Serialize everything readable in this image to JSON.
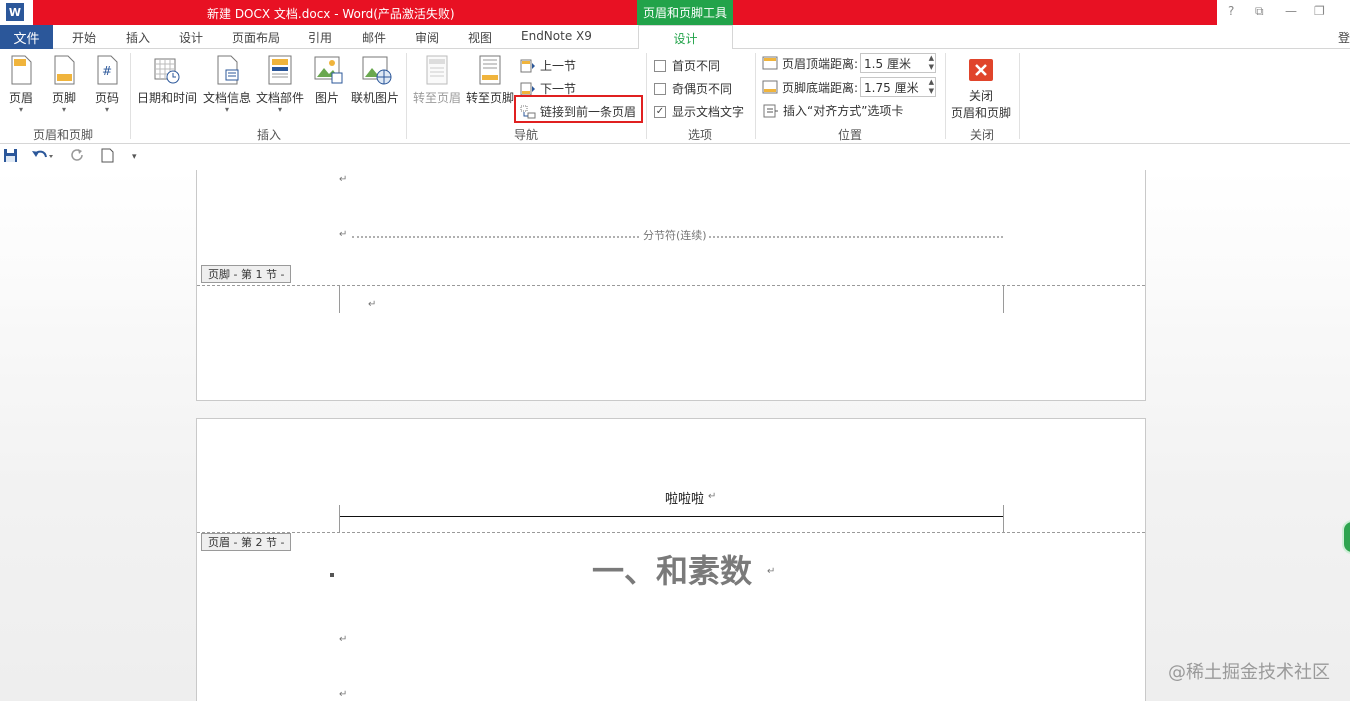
{
  "titlebar": {
    "app_icon_letter": "W",
    "title": "新建 DOCX 文档.docx -  Word(产品激活失败)",
    "context_tool": "页眉和页脚工具",
    "controls": [
      "?",
      "⧉",
      "—",
      "❐"
    ]
  },
  "tabs": {
    "file": "文件",
    "items": [
      "开始",
      "插入",
      "设计",
      "页面布局",
      "引用",
      "邮件",
      "审阅",
      "视图",
      "EndNote X9"
    ],
    "design": "设计",
    "signin": "登"
  },
  "ribbon": {
    "groups": {
      "header_footer": {
        "label": "页眉和页脚",
        "buttons": [
          "页眉",
          "页脚",
          "页码"
        ]
      },
      "insert": {
        "label": "插入",
        "buttons": [
          "日期和时间",
          "文档信息",
          "文档部件",
          "图片",
          "联机图片"
        ]
      },
      "navigation": {
        "label": "导航",
        "goto_header": "转至页眉",
        "goto_footer": "转至页脚",
        "prev_section": "上一节",
        "next_section": "下一节",
        "link_to_previous": "链接到前一条页眉"
      },
      "options": {
        "label": "选项",
        "first_page_diff": "首页不同",
        "odd_even_diff": "奇偶页不同",
        "show_doc_text": "显示文档文字",
        "show_doc_text_checked": true
      },
      "position": {
        "label": "位置",
        "header_top_label": "页眉顶端距离:",
        "header_top_value": "1.5 厘米",
        "footer_bottom_label": "页脚底端距离:",
        "footer_bottom_value": "1.75 厘米",
        "insert_align_tab": "插入“对齐方式”选项卡"
      },
      "close": {
        "label": "关闭",
        "button_line1": "关闭",
        "button_line2": "页眉和页脚"
      }
    },
    "colors": {
      "highlight": "#e02020",
      "file_tab": "#2b579a",
      "context": "#22a34a",
      "title_red": "#e81123"
    }
  },
  "qat": {
    "items": [
      "save-icon",
      "undo-icon",
      "redo-icon",
      "new-doc-icon",
      "customize-icon"
    ]
  },
  "document": {
    "paragraph_mark": "↵",
    "section_break": "分节符(连续)",
    "footer_tag": "页脚 - 第 1 节 -",
    "header_tag": "页眉 - 第 2 节 -",
    "header_text": "啦啦啦",
    "heading": "一、和素数"
  },
  "watermark": "@稀土掘金技术社区"
}
